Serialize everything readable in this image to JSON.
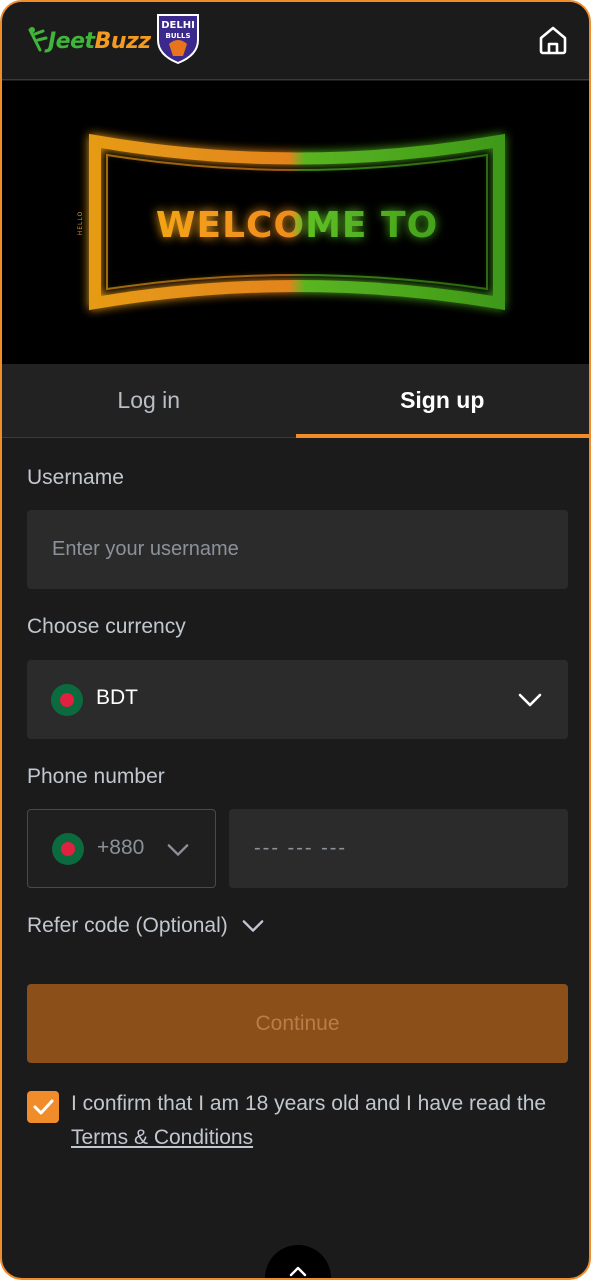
{
  "header": {
    "logo_green": "Jeet",
    "logo_orange": "Buzz",
    "partner_logo": "DELHI BULLS",
    "home_icon": "home-icon"
  },
  "banner": {
    "side_left": "HELLO",
    "headline": "WELCOME TO"
  },
  "tabs": [
    {
      "label": "Log in",
      "active": false
    },
    {
      "label": "Sign up",
      "active": true
    }
  ],
  "form": {
    "username_label": "Username",
    "username_placeholder": "Enter your username",
    "currency_label": "Choose currency",
    "currency_value": "BDT",
    "phone_label": "Phone number",
    "phone_code": "+880",
    "phone_placeholder": "--- --- ---",
    "refer_label": "Refer code (Optional)",
    "continue_label": "Continue",
    "confirm_text": "I confirm that I am 18 years old and I have read the",
    "terms_link": "Terms & Conditions",
    "confirm_checked": true
  },
  "colors": {
    "accent": "#f08c2a",
    "background": "#1b1b1b",
    "field": "#2b2b2b",
    "button_disabled": "#8b4f19"
  }
}
